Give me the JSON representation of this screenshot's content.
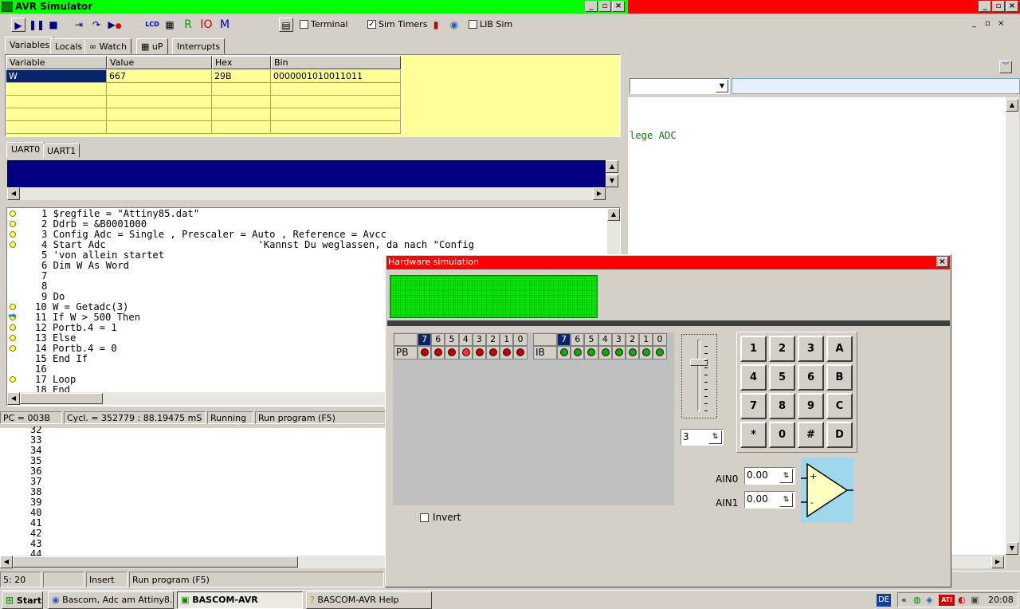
{
  "simulator": {
    "title": "AVR Simulator",
    "toolbar": {
      "terminal_label": "Terminal",
      "sim_timers_label": "Sim Timers",
      "lib_sim_label": "LIB Sim",
      "r_label": "R",
      "io_label": "IO",
      "m_label": "M"
    },
    "tabs": [
      "Variables",
      "Locals",
      "Watch",
      "uP",
      "Interrupts"
    ],
    "var_table": {
      "headers": [
        "Variable",
        "Value",
        "Hex",
        "Bin"
      ],
      "row": [
        "W",
        "667",
        "29B",
        "0000001010011011"
      ]
    },
    "uart_tabs": [
      "UART0",
      "UART1"
    ],
    "code_lines": [
      "1 $regfile = \"Attiny85.dat\"",
      "2 Ddrb = &B0001000",
      "3 Config Adc = Single , Prescaler = Auto , Reference = Avcc",
      "4 Start Adc                          'Kannst Du weglassen, da nach \"Config",
      "5 'von allein startet",
      "6 Dim W As Word",
      "7",
      "8",
      "9 Do",
      "10 W = Getadc(3)",
      "11 If W > 500 Then",
      "12 Portb.4 = 1",
      "13 Else",
      "14 Portb.4 = 0",
      "15 End If",
      "16",
      "17 Loop",
      "18 End"
    ],
    "status": {
      "pc": "PC = 003B",
      "cycles": "Cycl. = 352779 : 88.19475 mS",
      "state": "Running",
      "action": "Run program (F5)"
    }
  },
  "editor": {
    "visible_text": "lege ADC",
    "lower_lines": [
      "32",
      "33",
      "34",
      "35",
      "36",
      "37",
      "38",
      "39",
      "40",
      "41",
      "42",
      "43",
      "44"
    ],
    "status": {
      "pos": "5: 20",
      "mode": "Insert",
      "action": "Run program (F5)"
    }
  },
  "hw": {
    "title": "Hardware simulation",
    "bits": [
      "7",
      "6",
      "5",
      "4",
      "3",
      "2",
      "1",
      "0"
    ],
    "pb_label": "PB",
    "ib_label": "IB",
    "spin_value": "3",
    "keys": [
      "1",
      "2",
      "3",
      "A",
      "4",
      "5",
      "6",
      "B",
      "7",
      "8",
      "9",
      "C",
      "*",
      "0",
      "#",
      "D"
    ],
    "ain0_label": "AIN0",
    "ain0_value": "0.00",
    "ain1_label": "AIN1",
    "ain1_value": "0.00",
    "invert_label": "Invert",
    "pb4_on": true
  },
  "taskbar": {
    "start": "Start",
    "items": [
      "Bascom, Adc am Attiny8...",
      "BASCOM-AVR",
      "BASCOM-AVR Help"
    ],
    "lang": "DE",
    "time": "20:08"
  },
  "colors": {
    "title_green": "#00ff00",
    "title_red": "#ff0000",
    "var_bg": "#ffff99",
    "uart_bg": "#000080",
    "lcd_green": "#00ee00",
    "comp_bg": "#9fd8ec"
  }
}
